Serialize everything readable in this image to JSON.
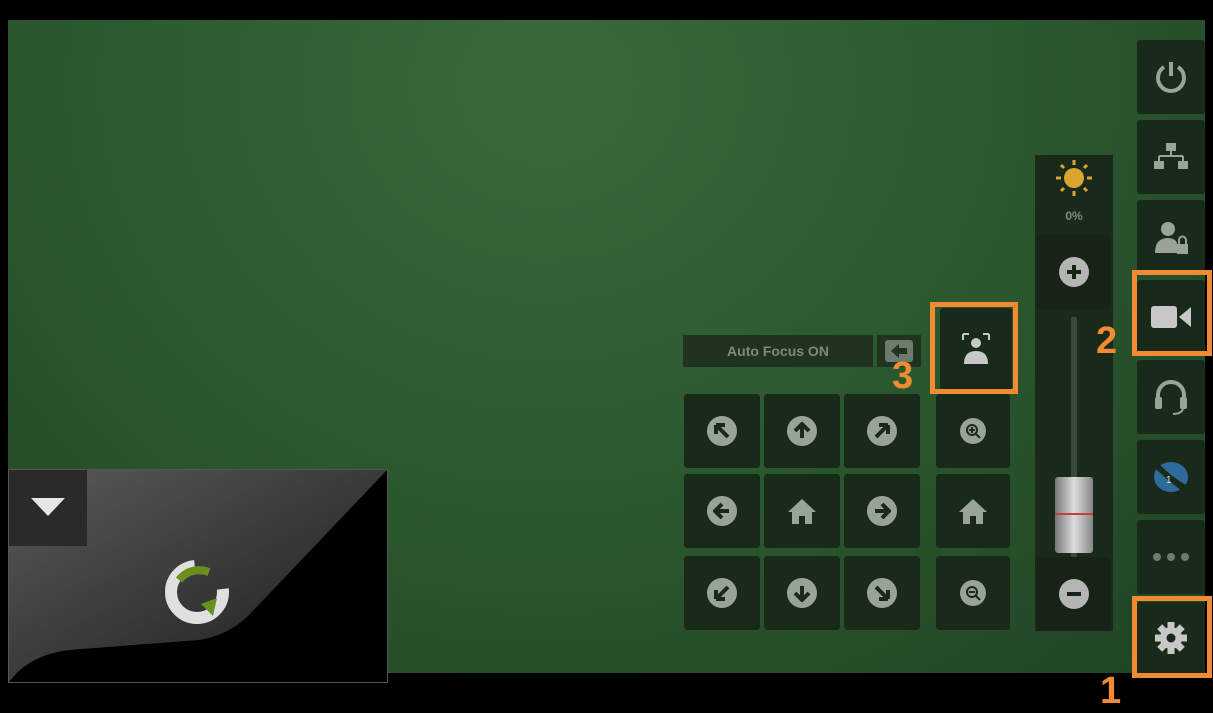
{
  "autofocus": {
    "label": "Auto Focus ON"
  },
  "brightness": {
    "value_label": "0%",
    "slider_level": 0.22
  },
  "callouts": {
    "one": "1",
    "two": "2",
    "three": "3"
  },
  "colors": {
    "accent": "#f08a33",
    "panel": "#1a2a1a",
    "background": "#2d5a30"
  },
  "sidebar": {
    "items": [
      {
        "icon": "power-icon"
      },
      {
        "icon": "network-icon"
      },
      {
        "icon": "user-lock-icon"
      },
      {
        "icon": "camera-icon"
      },
      {
        "icon": "headset-icon"
      },
      {
        "icon": "share-icon"
      },
      {
        "icon": "more-icon"
      },
      {
        "icon": "gear-icon"
      }
    ]
  }
}
